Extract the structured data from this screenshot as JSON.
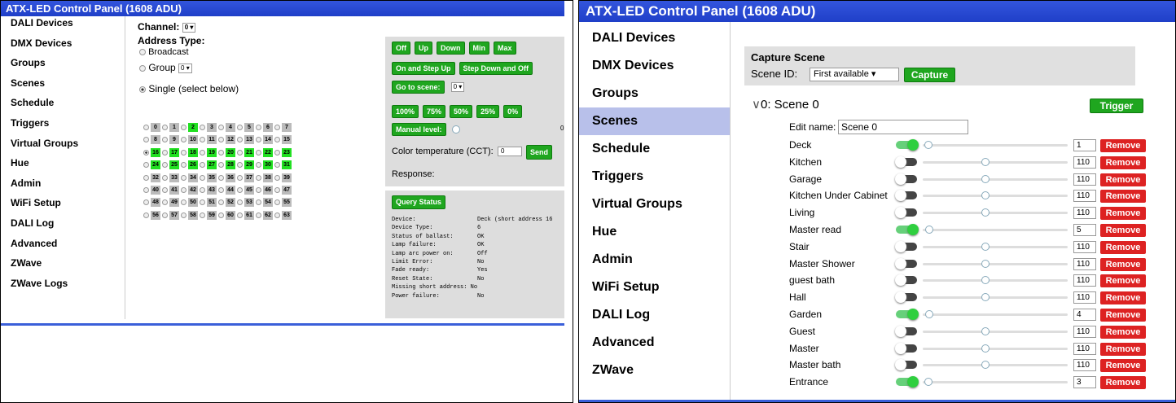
{
  "left_panel": {
    "title": "ATX-LED Control Panel (1608 ADU)",
    "nav": [
      "DALI Devices",
      "DMX Devices",
      "Groups",
      "Scenes",
      "Schedule",
      "Triggers",
      "Virtual Groups",
      "Hue",
      "Admin",
      "WiFi Setup",
      "DALI Log",
      "Advanced",
      "ZWave",
      "ZWave Logs"
    ],
    "channel_label": "Channel:",
    "channel_value": "0",
    "address_type_label": "Address Type:",
    "broadcast_label": "Broadcast",
    "group_label": "Group",
    "group_value": "0",
    "single_label": "Single (select below)",
    "address_grid": {
      "numbers": [
        0,
        1,
        2,
        3,
        4,
        5,
        6,
        7,
        8,
        9,
        10,
        11,
        12,
        13,
        14,
        15,
        16,
        17,
        18,
        19,
        20,
        21,
        22,
        23,
        24,
        25,
        26,
        27,
        28,
        29,
        30,
        31,
        32,
        33,
        34,
        35,
        36,
        37,
        38,
        39,
        40,
        41,
        42,
        43,
        44,
        45,
        46,
        47,
        48,
        49,
        50,
        51,
        52,
        53,
        54,
        55,
        56,
        57,
        58,
        59,
        60,
        61,
        62,
        63
      ],
      "highlighted": [
        2,
        16,
        17,
        18,
        19,
        20,
        21,
        22,
        23,
        24,
        25,
        26,
        27,
        28,
        29,
        30,
        31
      ],
      "selected": 16
    },
    "controls": {
      "row1": [
        "Off",
        "Up",
        "Down",
        "Min",
        "Max"
      ],
      "row2": [
        "On and Step Up",
        "Step Down and Off"
      ],
      "goto_label": "Go to scene:",
      "goto_value": "0",
      "percent_buttons": [
        "100%",
        "75%",
        "50%",
        "25%",
        "0%"
      ],
      "manual_label": "Manual level:",
      "manual_level": 0,
      "manual_value_text": "0",
      "cct_label": "Color temperature (CCT):",
      "cct_value": "0",
      "send_label": "Send",
      "response_label": "Response:"
    },
    "status": {
      "button": "Query Status",
      "text": "Device:                  Deck (short address 16\nDevice Type:             6\nStatus of ballast:       OK\nLamp failure:            OK\nLamp arc power on:       Off\nLimit Error:             No\nFade ready:              Yes\nReset State:             No\nMissing short address: No\nPower failure:           No"
    }
  },
  "right_panel": {
    "title": "ATX-LED Control Panel (1608 ADU)",
    "nav": [
      "DALI Devices",
      "DMX Devices",
      "Groups",
      "Scenes",
      "Schedule",
      "Triggers",
      "Virtual Groups",
      "Hue",
      "Admin",
      "WiFi Setup",
      "DALI Log",
      "Advanced",
      "ZWave"
    ],
    "active_nav": "Scenes",
    "capture": {
      "title": "Capture Scene",
      "scene_id_label": "Scene ID:",
      "scene_id_value": "First available",
      "capture_button": "Capture"
    },
    "scene": {
      "heading": "0: Scene 0",
      "trigger_button": "Trigger",
      "edit_name_label": "Edit name:",
      "edit_name_value": "Scene 0",
      "remove_label": "Remove",
      "devices": [
        {
          "name": "Deck",
          "on": true,
          "value": "1",
          "level": 0.01
        },
        {
          "name": "Kitchen",
          "on": false,
          "value": "110",
          "level": 0.43
        },
        {
          "name": "Garage",
          "on": false,
          "value": "110",
          "level": 0.43
        },
        {
          "name": "Kitchen Under Cabinet",
          "on": false,
          "value": "110",
          "level": 0.43
        },
        {
          "name": "Living",
          "on": false,
          "value": "110",
          "level": 0.43
        },
        {
          "name": "Master read",
          "on": true,
          "value": "5",
          "level": 0.02
        },
        {
          "name": "Stair",
          "on": false,
          "value": "110",
          "level": 0.43
        },
        {
          "name": "Master Shower",
          "on": false,
          "value": "110",
          "level": 0.43
        },
        {
          "name": "guest bath",
          "on": false,
          "value": "110",
          "level": 0.43
        },
        {
          "name": "Hall",
          "on": false,
          "value": "110",
          "level": 0.43
        },
        {
          "name": "Garden",
          "on": true,
          "value": "4",
          "level": 0.015
        },
        {
          "name": "Guest",
          "on": false,
          "value": "110",
          "level": 0.43
        },
        {
          "name": "Master",
          "on": false,
          "value": "110",
          "level": 0.43
        },
        {
          "name": "Master bath",
          "on": false,
          "value": "110",
          "level": 0.43
        },
        {
          "name": "Entrance",
          "on": true,
          "value": "3",
          "level": 0.01
        }
      ]
    }
  }
}
